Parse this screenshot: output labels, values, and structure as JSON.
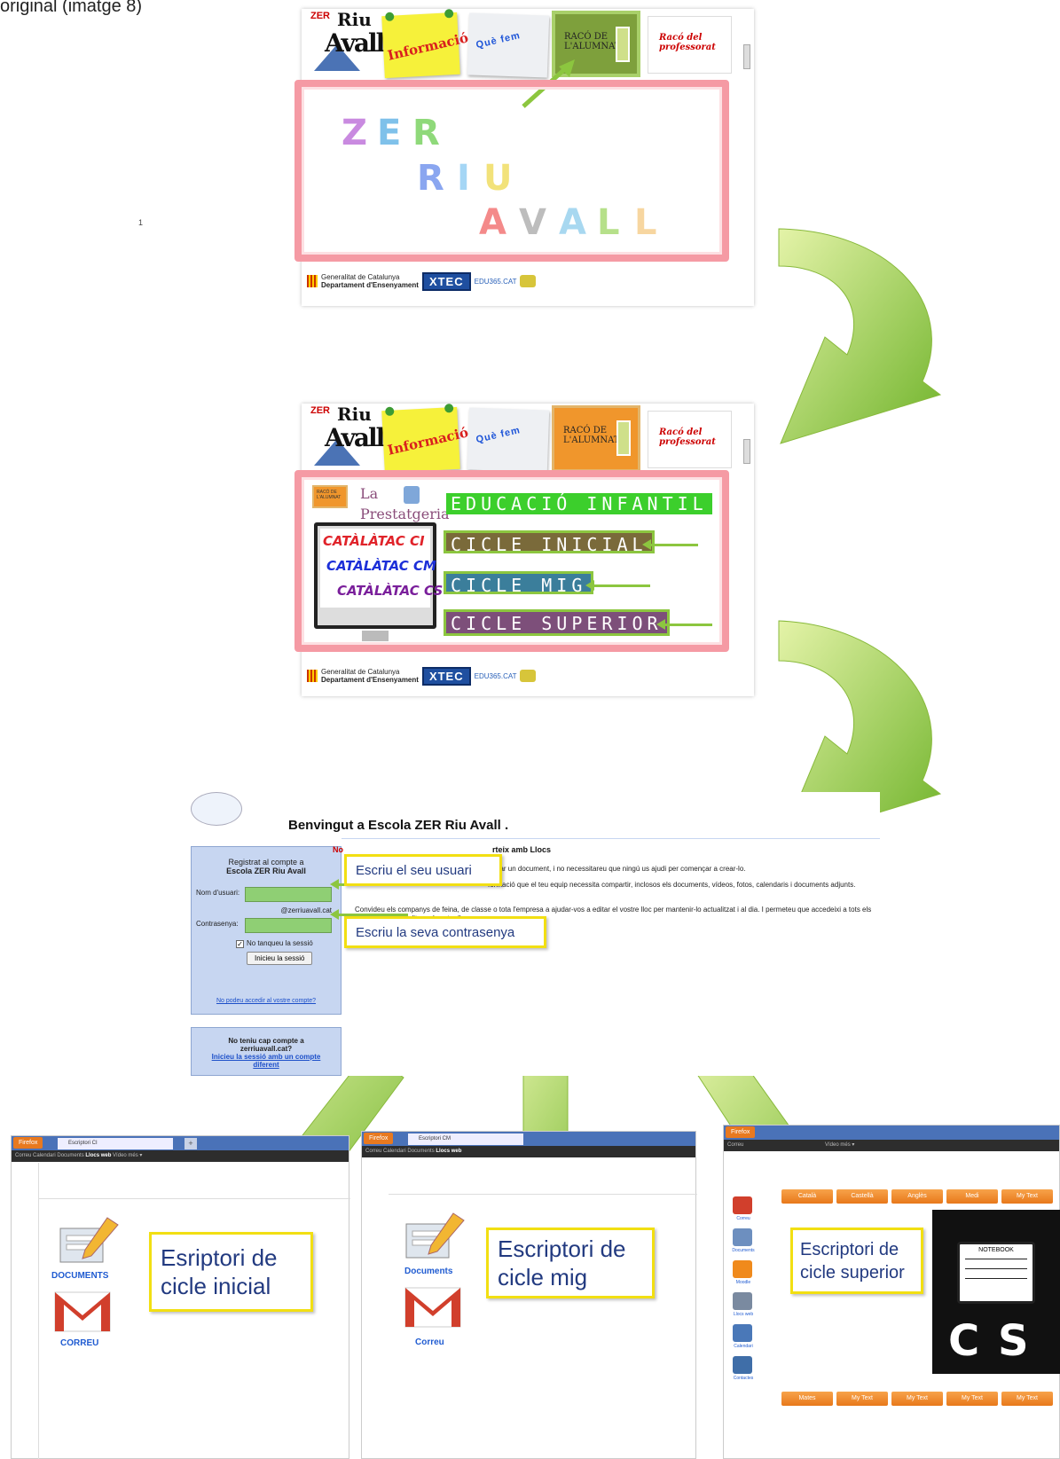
{
  "caption_top": "original (imatge 8)",
  "page_number": "1",
  "site": {
    "logo_zer": "ZER",
    "logo_riu": "Riu",
    "logo_avall": "Avall",
    "tile_informacio": "Informació",
    "tile_que_fem": "Què fem",
    "tile_raco_alumnat": "RACÓ DE L'ALUMNAT",
    "tile_raco_professorat": "Racó del professorat",
    "footer_generalitat": "Generalitat de Catalunya",
    "footer_departament": "Departament d'Ensenyament",
    "footer_xtec": "XTEC",
    "footer_edu": "EDU365.CAT"
  },
  "frame1": {
    "letters": [
      {
        "t": "Z",
        "c": "#c98ae0"
      },
      {
        "t": "E",
        "c": "#7fc1ea"
      },
      {
        "t": "R",
        "c": "#8fd97a"
      },
      {
        "t": "R",
        "c": "#8aa6f0"
      },
      {
        "t": "I",
        "c": "#a5d6f5"
      },
      {
        "t": "U",
        "c": "#f2e27a"
      },
      {
        "t": "A",
        "c": "#f48a8a"
      },
      {
        "t": "V",
        "c": "#bdbdbd"
      },
      {
        "t": "A",
        "c": "#a8d8f0"
      },
      {
        "t": "L",
        "c": "#b6e08a"
      },
      {
        "t": "L",
        "c": "#f7d6a0"
      }
    ]
  },
  "frame2": {
    "la": "La",
    "prestatgeria": "Prestatgeria",
    "educacio_infantil": "EDUCACIÓ INFANTIL",
    "cicle_inicial": "CICLE INICIAL",
    "cicle_mig": "CICLE MIG",
    "cicle_superior": "CICLE SUPERIOR",
    "catalatac_ci": "CATÀLÀTAC CI",
    "catalatac_cm": "CATÀLÀTAC CM",
    "catalatac_cs": "CATÀLÀTAC CS",
    "raco_label": "RACÓ DE L'ALUMNAT"
  },
  "login": {
    "welcome": "Benvingut a Escola ZER Riu Avall .",
    "panel_title_1": "Registrat al compte a",
    "panel_title_2": "Escola ZER Riu Avall",
    "nom_usuari": "Nom d'usuari:",
    "domain": "@zerriuavall.cat",
    "contrasenya": "Contrasenya:",
    "no_tanqueu": "No tanqueu la sessió",
    "inicieu": "Inicieu la sessió",
    "no_podeu": "No podeu accedir al vostre compte?",
    "no_teniu_1": "No teniu cap compte a",
    "no_teniu_2": "zerriuavall.cat?",
    "inicieu_diferent": "Inicieu la sessió amb un compte diferent",
    "heading_no": "No",
    "heading_rest": "rteix amb Llocs",
    "para1": "ditar un document, i no necessitareu que ningú us ajudi per començar a crear-lo.",
    "para2": "formació que el teu equip necessita compartir, inclosos els documents, vídeos, fotos, calendaris i documents adjunts.",
    "para3": "Convideu els companys de feina, de classe o tota l'empresa a ajudar-vos a editar el vostre lloc per mantenir-lo actualitzat i al dia. I permeteu que accedeixi a tots els que vulgueu visualitzar el vostre lloc.",
    "callout_usuari": "Escriu el seu usuari",
    "callout_contrasenya": "Escriu la seva contrasenya"
  },
  "desktops": {
    "firefox": "Firefox",
    "tab1": "Escriptori CI",
    "tab2": "Escriptori CM",
    "gbar1_a": "Correu  Calendari  Documents  ",
    "gbar1_b": "Llocs web",
    "gbar1_c": "  Vídeo  més ▾",
    "gbar2_a": "Correu  Calendari  Documents  ",
    "gbar2_b": "Llocs web",
    "gbar3_a": "Correu",
    "gbar3_c": "  Vídeo  més ▾",
    "documents_upper": "DOCUMENTS",
    "correu_upper": "CORREU",
    "documents": "Documents",
    "correu": "Correu",
    "callout_ci": "Esriptori de cicle inicial",
    "callout_cm": "Escriptori de cicle mig",
    "callout_cs": "Escriptori de cicle superior",
    "cs_tabs_top": [
      "Català",
      "Castellà",
      "Anglès",
      "Medi",
      "My Text"
    ],
    "cs_tabs_bottom": [
      "Mates",
      "My Text",
      "My Text",
      "My Text",
      "My Text"
    ],
    "cs_side": [
      "Correu",
      "Documents",
      "Moodle",
      "Llocs web",
      "Calendari",
      "Contactes"
    ],
    "notebook": "NOTEBOOK",
    "cs_big": "C S"
  },
  "colors": {
    "arrow_green": "#8cc63f",
    "frame_pink": "#f59aa4",
    "callout_yellow": "#f2df12",
    "bar_infantil": "#3ccf2c",
    "bar_inicial": "#7a6a3a",
    "bar_mig": "#3b7e9b",
    "bar_superior": "#7d4f7a"
  }
}
